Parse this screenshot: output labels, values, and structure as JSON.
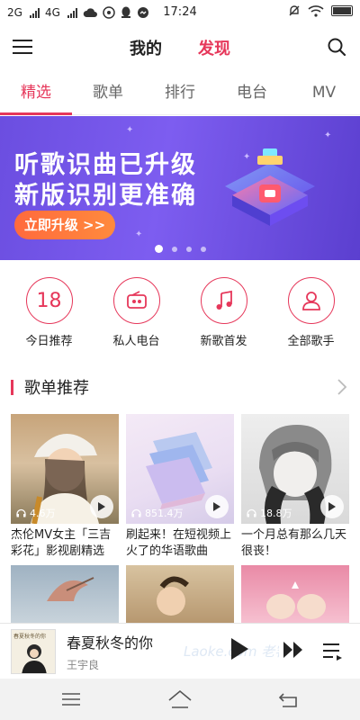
{
  "status_bar": {
    "network_left": "2G",
    "network_right": "4G",
    "time": "17:24"
  },
  "header": {
    "tabs": [
      {
        "label": "我的",
        "active": false
      },
      {
        "label": "发现",
        "active": true
      }
    ],
    "icons": [
      "menu-icon",
      "search-icon"
    ]
  },
  "sub_tabs": [
    {
      "label": "精选",
      "active": true
    },
    {
      "label": "歌单",
      "active": false
    },
    {
      "label": "排行",
      "active": false
    },
    {
      "label": "电台",
      "active": false
    },
    {
      "label": "MV",
      "active": false
    }
  ],
  "banner": {
    "line1": "听歌识曲已升级",
    "line2": "新版识别更准确",
    "cta": "立即升级 >>",
    "slide_count": 4,
    "active_slide": 1
  },
  "quick_entries": [
    {
      "icon_text": "18",
      "icon": "calendar-icon",
      "label": "今日推荐"
    },
    {
      "icon_text": "",
      "icon": "radio-icon",
      "label": "私人电台"
    },
    {
      "icon_text": "",
      "icon": "music-note-icon",
      "label": "新歌首发"
    },
    {
      "icon_text": "",
      "icon": "person-icon",
      "label": "全部歌手"
    }
  ],
  "section": {
    "title": "歌单推荐"
  },
  "playlists": [
    {
      "play_count": "4.6万",
      "title": "杰伦MV女主「三吉彩花」影视剧精选"
    },
    {
      "play_count": "851.4万",
      "title": "刷起来！在短视频上火了的华语歌曲"
    },
    {
      "play_count": "18.8万",
      "title": "一个月总有那么几天很丧！"
    }
  ],
  "player": {
    "song": "春夏秋冬的你",
    "artist": "王宇良",
    "album_caption": "春夏秋冬的你"
  },
  "watermark": "Laoke.com 老客",
  "colors": {
    "accent": "#e6375a",
    "banner_bg": "#6b4ee0",
    "cta": "#ff6a3d"
  }
}
